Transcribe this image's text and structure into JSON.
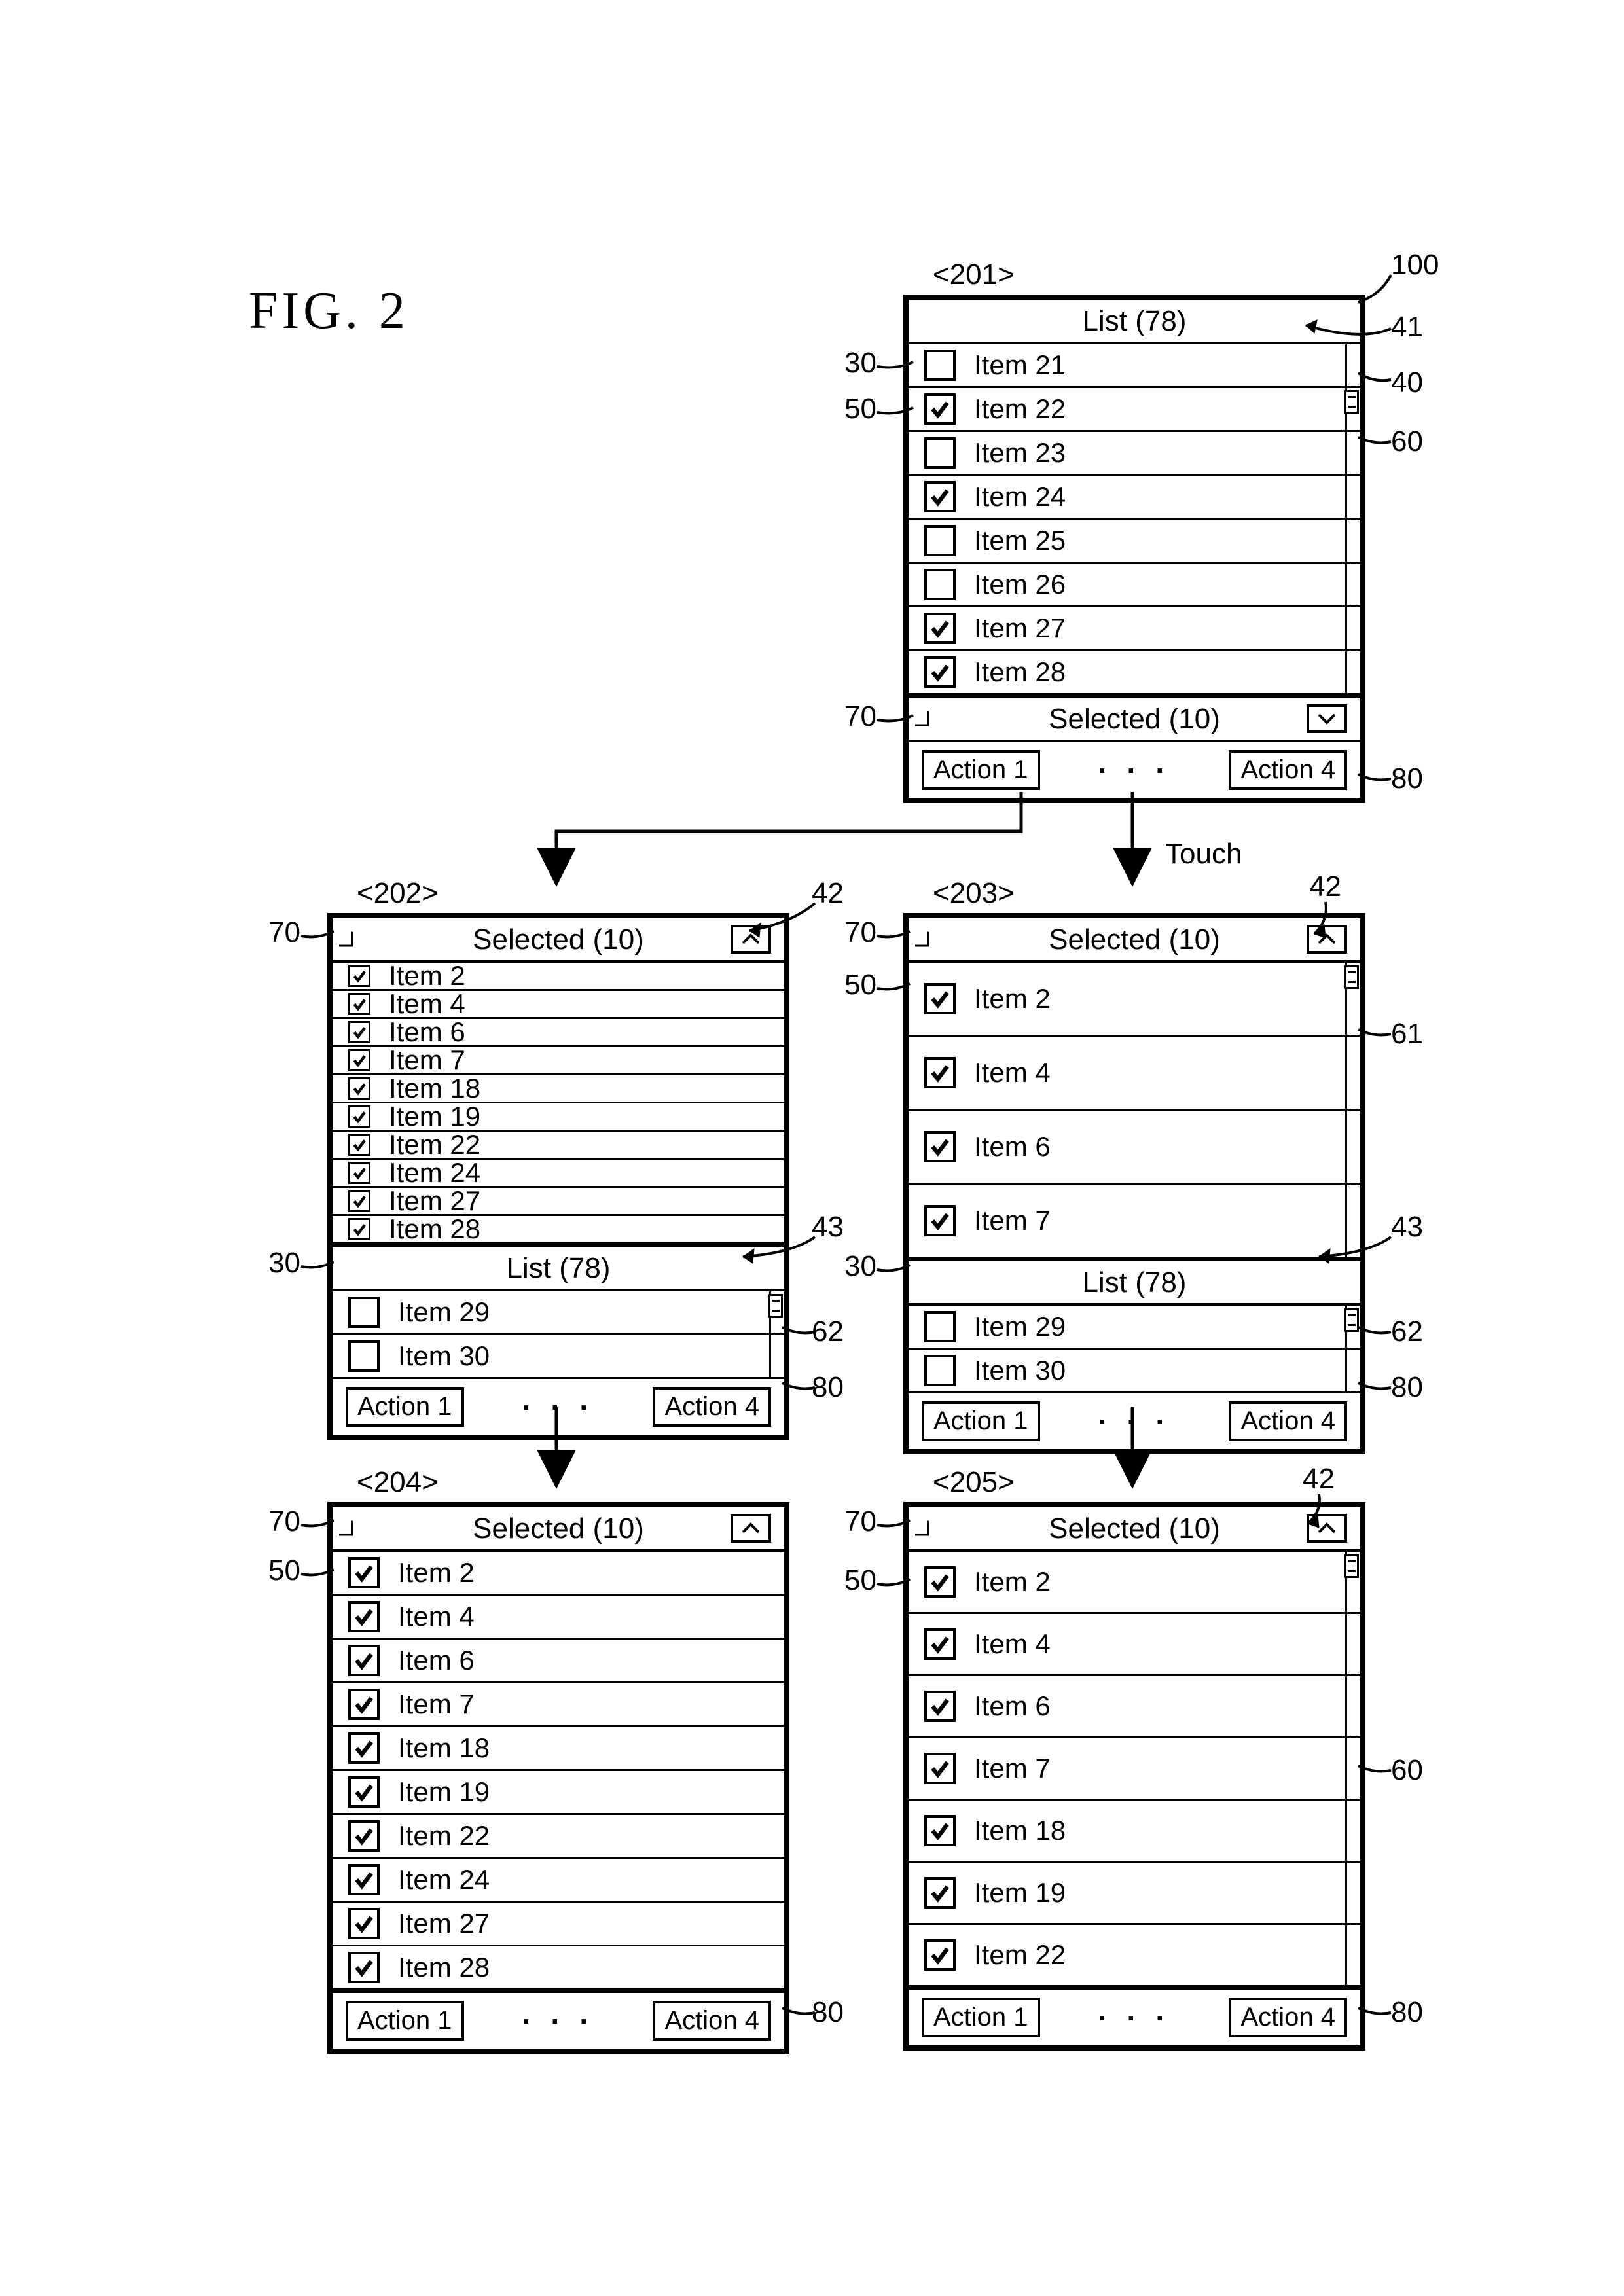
{
  "figure_label": "FIG. 2",
  "touch_label": "Touch",
  "action1": "Action 1",
  "action4": "Action 4",
  "screens": {
    "s201": {
      "tag": "<201>",
      "title": "List (78)",
      "items": [
        {
          "label": "Item 21",
          "checked": false
        },
        {
          "label": "Item 22",
          "checked": true
        },
        {
          "label": "Item 23",
          "checked": false
        },
        {
          "label": "Item 24",
          "checked": true
        },
        {
          "label": "Item 25",
          "checked": false
        },
        {
          "label": "Item 26",
          "checked": false
        },
        {
          "label": "Item 27",
          "checked": true
        },
        {
          "label": "Item 28",
          "checked": true
        }
      ],
      "selected_bar": "Selected (10)"
    },
    "s202": {
      "tag": "<202>",
      "selected_bar": "Selected (10)",
      "items": [
        {
          "label": "Item 2",
          "checked": true
        },
        {
          "label": "Item 4",
          "checked": true
        },
        {
          "label": "Item 6",
          "checked": true
        },
        {
          "label": "Item 7",
          "checked": true
        },
        {
          "label": "Item 18",
          "checked": true
        },
        {
          "label": "Item 19",
          "checked": true
        },
        {
          "label": "Item 22",
          "checked": true
        },
        {
          "label": "Item 24",
          "checked": true
        },
        {
          "label": "Item 27",
          "checked": true
        },
        {
          "label": "Item 28",
          "checked": true
        }
      ],
      "list_title": "List (78)",
      "tail": [
        {
          "label": "Item 29",
          "checked": false
        },
        {
          "label": "Item 30",
          "checked": false
        }
      ]
    },
    "s203": {
      "tag": "<203>",
      "selected_bar": "Selected (10)",
      "items": [
        {
          "label": "Item 2",
          "checked": true
        },
        {
          "label": "Item 4",
          "checked": true
        },
        {
          "label": "Item 6",
          "checked": true
        },
        {
          "label": "Item 7",
          "checked": true
        }
      ],
      "list_title": "List (78)",
      "tail": [
        {
          "label": "Item 29",
          "checked": false
        },
        {
          "label": "Item 30",
          "checked": false
        }
      ]
    },
    "s204": {
      "tag": "<204>",
      "selected_bar": "Selected (10)",
      "items": [
        {
          "label": "Item 2",
          "checked": true
        },
        {
          "label": "Item 4",
          "checked": true
        },
        {
          "label": "Item 6",
          "checked": true
        },
        {
          "label": "Item 7",
          "checked": true
        },
        {
          "label": "Item 18",
          "checked": true
        },
        {
          "label": "Item 19",
          "checked": true
        },
        {
          "label": "Item 22",
          "checked": true
        },
        {
          "label": "Item 24",
          "checked": true
        },
        {
          "label": "Item 27",
          "checked": true
        },
        {
          "label": "Item 28",
          "checked": true
        }
      ]
    },
    "s205": {
      "tag": "<205>",
      "selected_bar": "Selected (10)",
      "items": [
        {
          "label": "Item 2",
          "checked": true
        },
        {
          "label": "Item 4",
          "checked": true
        },
        {
          "label": "Item 6",
          "checked": true
        },
        {
          "label": "Item 7",
          "checked": true
        },
        {
          "label": "Item 18",
          "checked": true
        },
        {
          "label": "Item 19",
          "checked": true
        },
        {
          "label": "Item 22",
          "checked": true
        }
      ]
    }
  },
  "refs": {
    "r100": "100",
    "r41": "41",
    "r40": "40",
    "r60": "60",
    "r61": "61",
    "r62": "62",
    "r30": "30",
    "r50": "50",
    "r70": "70",
    "r80": "80",
    "r42": "42",
    "r43": "43"
  }
}
